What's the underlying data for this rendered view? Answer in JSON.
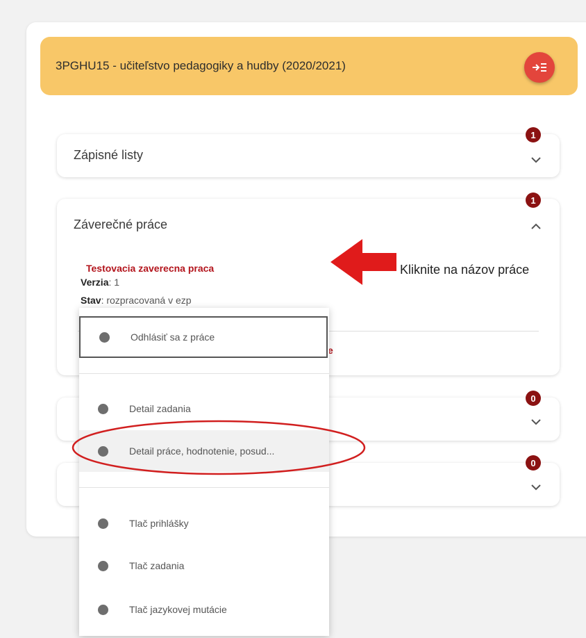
{
  "program": {
    "title": "3PGHU15 - učiteľstvo pedagogiky a hudby (2020/2021)"
  },
  "sections": [
    {
      "title": "Zápisné listy",
      "badge": "1"
    },
    {
      "title": "Záverečné práce",
      "badge": "1"
    },
    {
      "title": "",
      "badge": "0"
    },
    {
      "title": "",
      "badge": "0"
    }
  ],
  "thesis": {
    "title": "Testovacia zaverecna praca",
    "version_label": "Verzia",
    "version_value": ": 1",
    "status_label": "Stav",
    "status_value": ": rozpracovaná v ezp",
    "partial_hidden_text": "e"
  },
  "annotation": {
    "instruction": "Kliknite na názov práce"
  },
  "context_menu": {
    "items": [
      "Odhlásiť sa z práce",
      "Detail zadania",
      "Detail práce, hodnotenie, posud...",
      "Tlač prihlášky",
      "Tlač zadania",
      "Tlač jazykovej mutácie"
    ]
  },
  "colors": {
    "header_bg": "#f8c768",
    "accent_red": "#e3453c",
    "badge_bg": "#8b1212",
    "link_red": "#b3141c"
  }
}
